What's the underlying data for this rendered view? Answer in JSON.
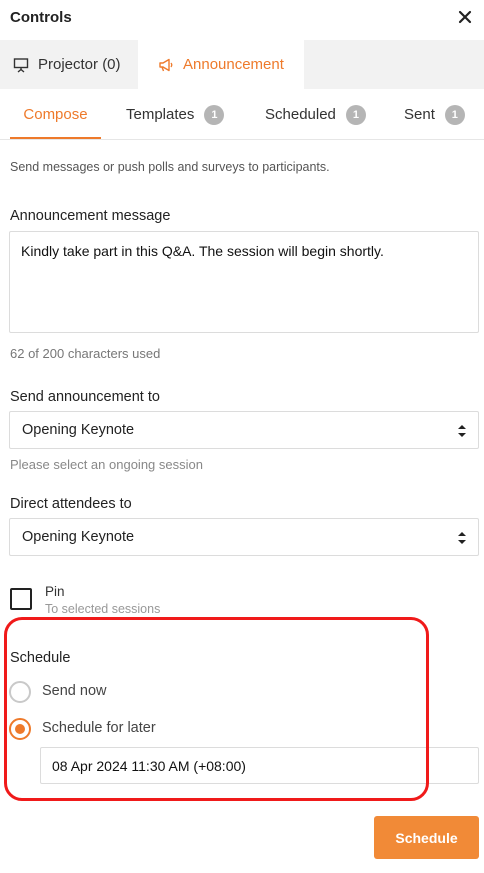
{
  "header": {
    "title": "Controls",
    "close_icon": "close-icon"
  },
  "main_tabs": [
    {
      "label": "Projector (0)",
      "icon": "projector-icon"
    },
    {
      "label": "Announcement",
      "icon": "megaphone-icon",
      "active": true
    }
  ],
  "sub_tabs": [
    {
      "label": "Compose",
      "active": true
    },
    {
      "label": "Templates",
      "badge": "1"
    },
    {
      "label": "Scheduled",
      "badge": "1"
    },
    {
      "label": "Sent",
      "badge": "1"
    }
  ],
  "compose": {
    "hint": "Send messages or push polls and surveys to participants.",
    "message_label": "Announcement message",
    "message_value": "Kindly take part in this Q&A. The session will begin shortly.",
    "char_counter": "62 of 200 characters used",
    "send_to_label": "Send announcement to",
    "send_to_value": "Opening Keynote",
    "send_to_hint": "Please select an ongoing session",
    "direct_label": "Direct attendees to",
    "direct_value": "Opening Keynote",
    "pin_label": "Pin",
    "pin_sub": "To selected sessions",
    "pin_checked": false
  },
  "schedule": {
    "title": "Schedule",
    "options": [
      {
        "label": "Send now",
        "checked": false
      },
      {
        "label": "Schedule for later",
        "checked": true
      }
    ],
    "datetime_value": "08 Apr 2024 11:30 AM (+08:00)"
  },
  "submit_label": "Schedule",
  "colors": {
    "accent": "#ee7a2b",
    "button": "#f18a37",
    "highlight": "#f01a1a",
    "badge": "#b5b5b5"
  }
}
